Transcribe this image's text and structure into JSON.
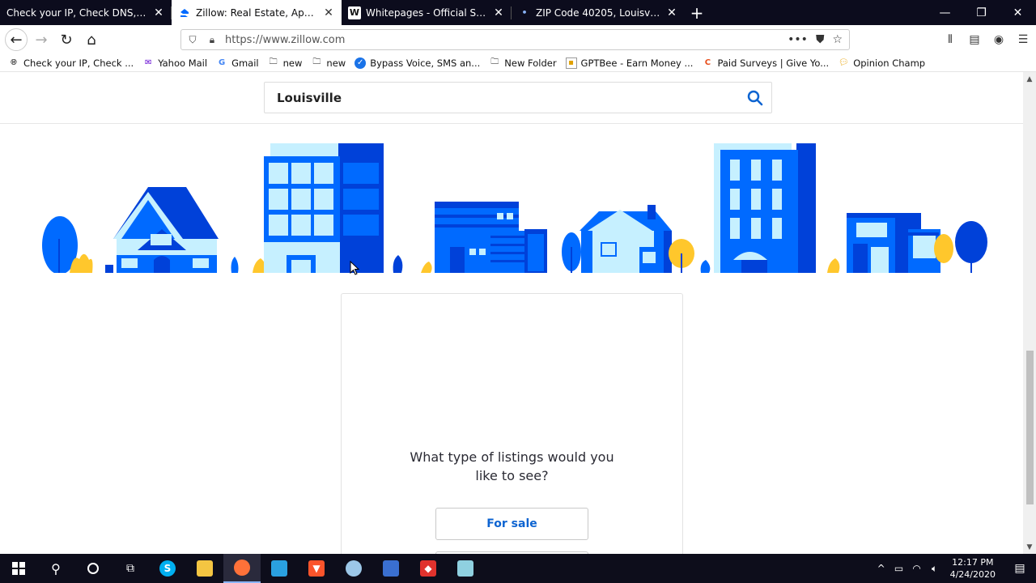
{
  "browser": {
    "tabs": [
      {
        "title": "Check your IP, Check DNS, Check f",
        "favicon": "globe-icon",
        "active": false
      },
      {
        "title": "Zillow: Real Estate, Apartments",
        "favicon": "zillow-icon",
        "active": true
      },
      {
        "title": "Whitepages - Official Site | Find",
        "favicon": "whitepages-icon",
        "active": false
      },
      {
        "title": "ZIP Code 40205, Louisville KY, U",
        "favicon": "dot-icon",
        "active": false
      }
    ],
    "url": "https://www.zillow.com",
    "bookmarks": [
      {
        "label": "Check your IP, Check ...",
        "icon": "globe-icon"
      },
      {
        "label": "Yahoo Mail",
        "icon": "yahoo-icon"
      },
      {
        "label": "Gmail",
        "icon": "google-icon"
      },
      {
        "label": "new",
        "icon": "folder-icon"
      },
      {
        "label": "new",
        "icon": "folder-icon"
      },
      {
        "label": "Bypass Voice, SMS an...",
        "icon": "check-icon"
      },
      {
        "label": "New Folder",
        "icon": "folder-icon"
      },
      {
        "label": "GPTBee - Earn Money ...",
        "icon": "gptbee-icon"
      },
      {
        "label": "Paid Surveys | Give Yo...",
        "icon": "surveys-icon"
      },
      {
        "label": "Opinion Champ",
        "icon": "speech-icon"
      }
    ]
  },
  "page": {
    "search_value": "Louisville",
    "question_line1": "What type of listings would you",
    "question_line2": "like to see?",
    "for_sale_label": "For sale"
  },
  "taskbar": {
    "time": "12:17 PM",
    "date": "4/24/2020"
  },
  "colors": {
    "brand_blue": "#0d64d1",
    "illustration_blue": "#006aff",
    "illustration_dark": "#0041d9",
    "illustration_light": "#c6f0ff",
    "illustration_yellow": "#ffc72c"
  }
}
